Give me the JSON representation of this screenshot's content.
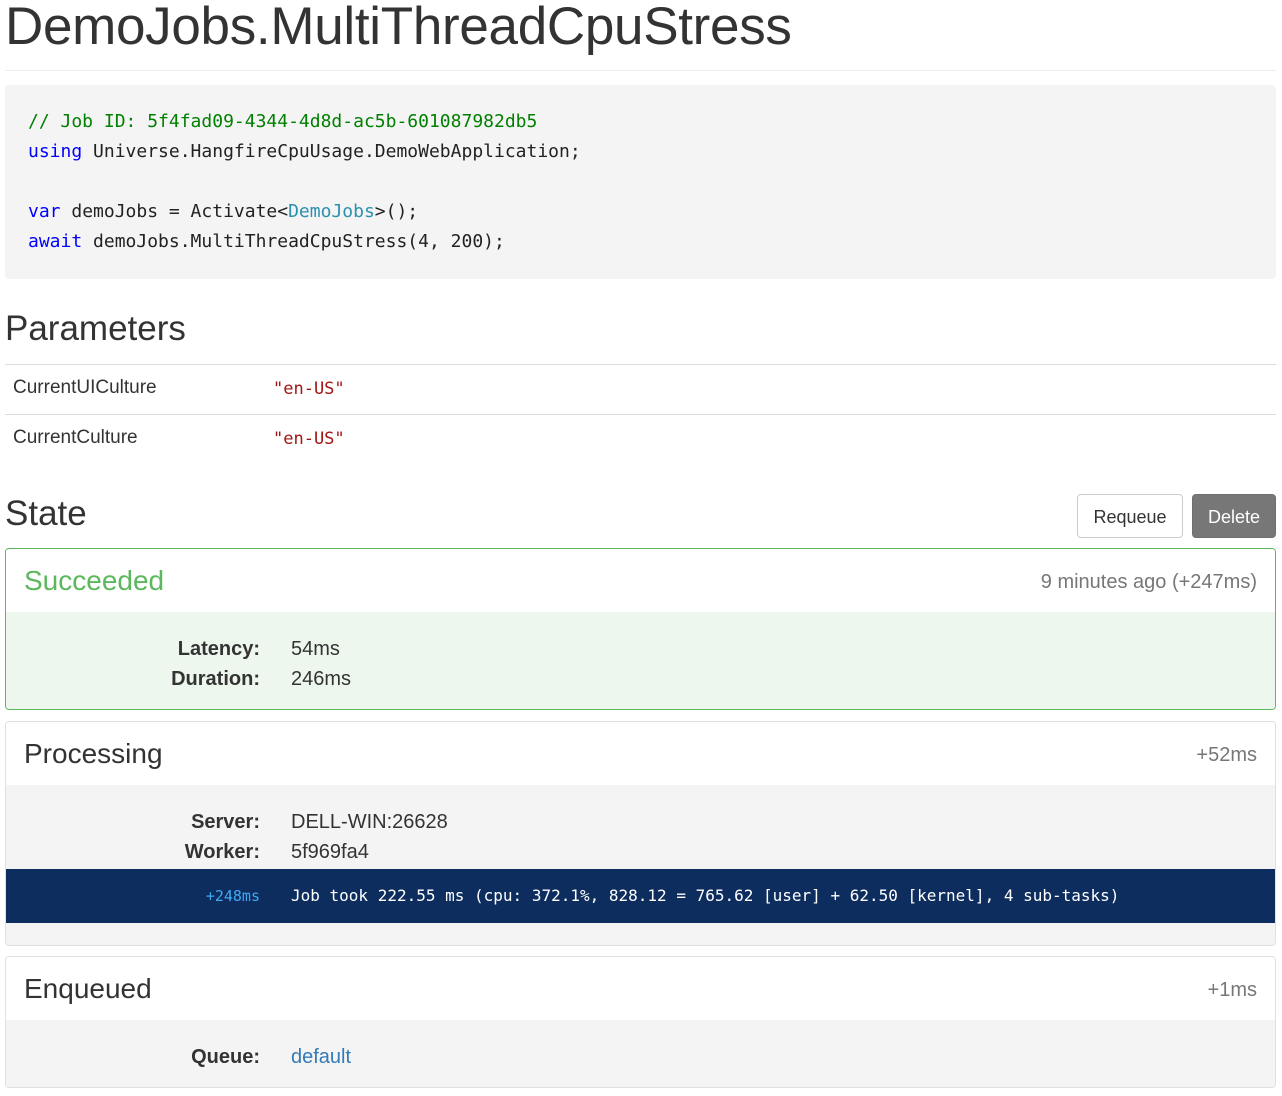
{
  "page": {
    "title": "DemoJobs.MultiThreadCpuStress"
  },
  "code": {
    "comment": "// Job ID: 5f4fad09-4344-4d8d-ac5b-601087982db5",
    "using_keyword": "using",
    "using_namespace": " Universe.HangfireCpuUsage.DemoWebApplication;",
    "var_keyword": "var",
    "var_assign": " demoJobs = Activate<",
    "var_type": "DemoJobs",
    "var_end": ">();",
    "await_keyword": "await",
    "await_call": " demoJobs.MultiThreadCpuStress(4, 200);"
  },
  "parameters": {
    "heading": "Parameters",
    "rows": [
      {
        "name": "CurrentUICulture",
        "value": "\"en-US\""
      },
      {
        "name": "CurrentCulture",
        "value": "\"en-US\""
      }
    ]
  },
  "state": {
    "heading": "State",
    "requeue_label": "Requeue",
    "delete_label": "Delete",
    "cards": [
      {
        "title": "Succeeded",
        "time": "9 minutes ago (+247ms)",
        "fields": [
          {
            "label": "Latency:",
            "value": "54ms"
          },
          {
            "label": "Duration:",
            "value": "246ms"
          }
        ]
      },
      {
        "title": "Processing",
        "time": "+52ms",
        "fields": [
          {
            "label": "Server:",
            "value": "DELL-WIN:26628"
          },
          {
            "label": "Worker:",
            "value": "5f969fa4"
          }
        ],
        "console": {
          "time": "+248ms",
          "message": "Job took 222.55 ms (cpu: 372.1%, 828.12 = 765.62 [user] + 62.50 [kernel], 4 sub-tasks)"
        }
      },
      {
        "title": "Enqueued",
        "time": "+1ms",
        "fields": [
          {
            "label": "Queue:",
            "value": "default"
          }
        ]
      }
    ]
  },
  "colors": {
    "success": "#5cb85c",
    "success_bg": "#edf7ee",
    "console_bg": "#0d2d5e",
    "link": "#337ab7",
    "delete_button": "#777777"
  }
}
